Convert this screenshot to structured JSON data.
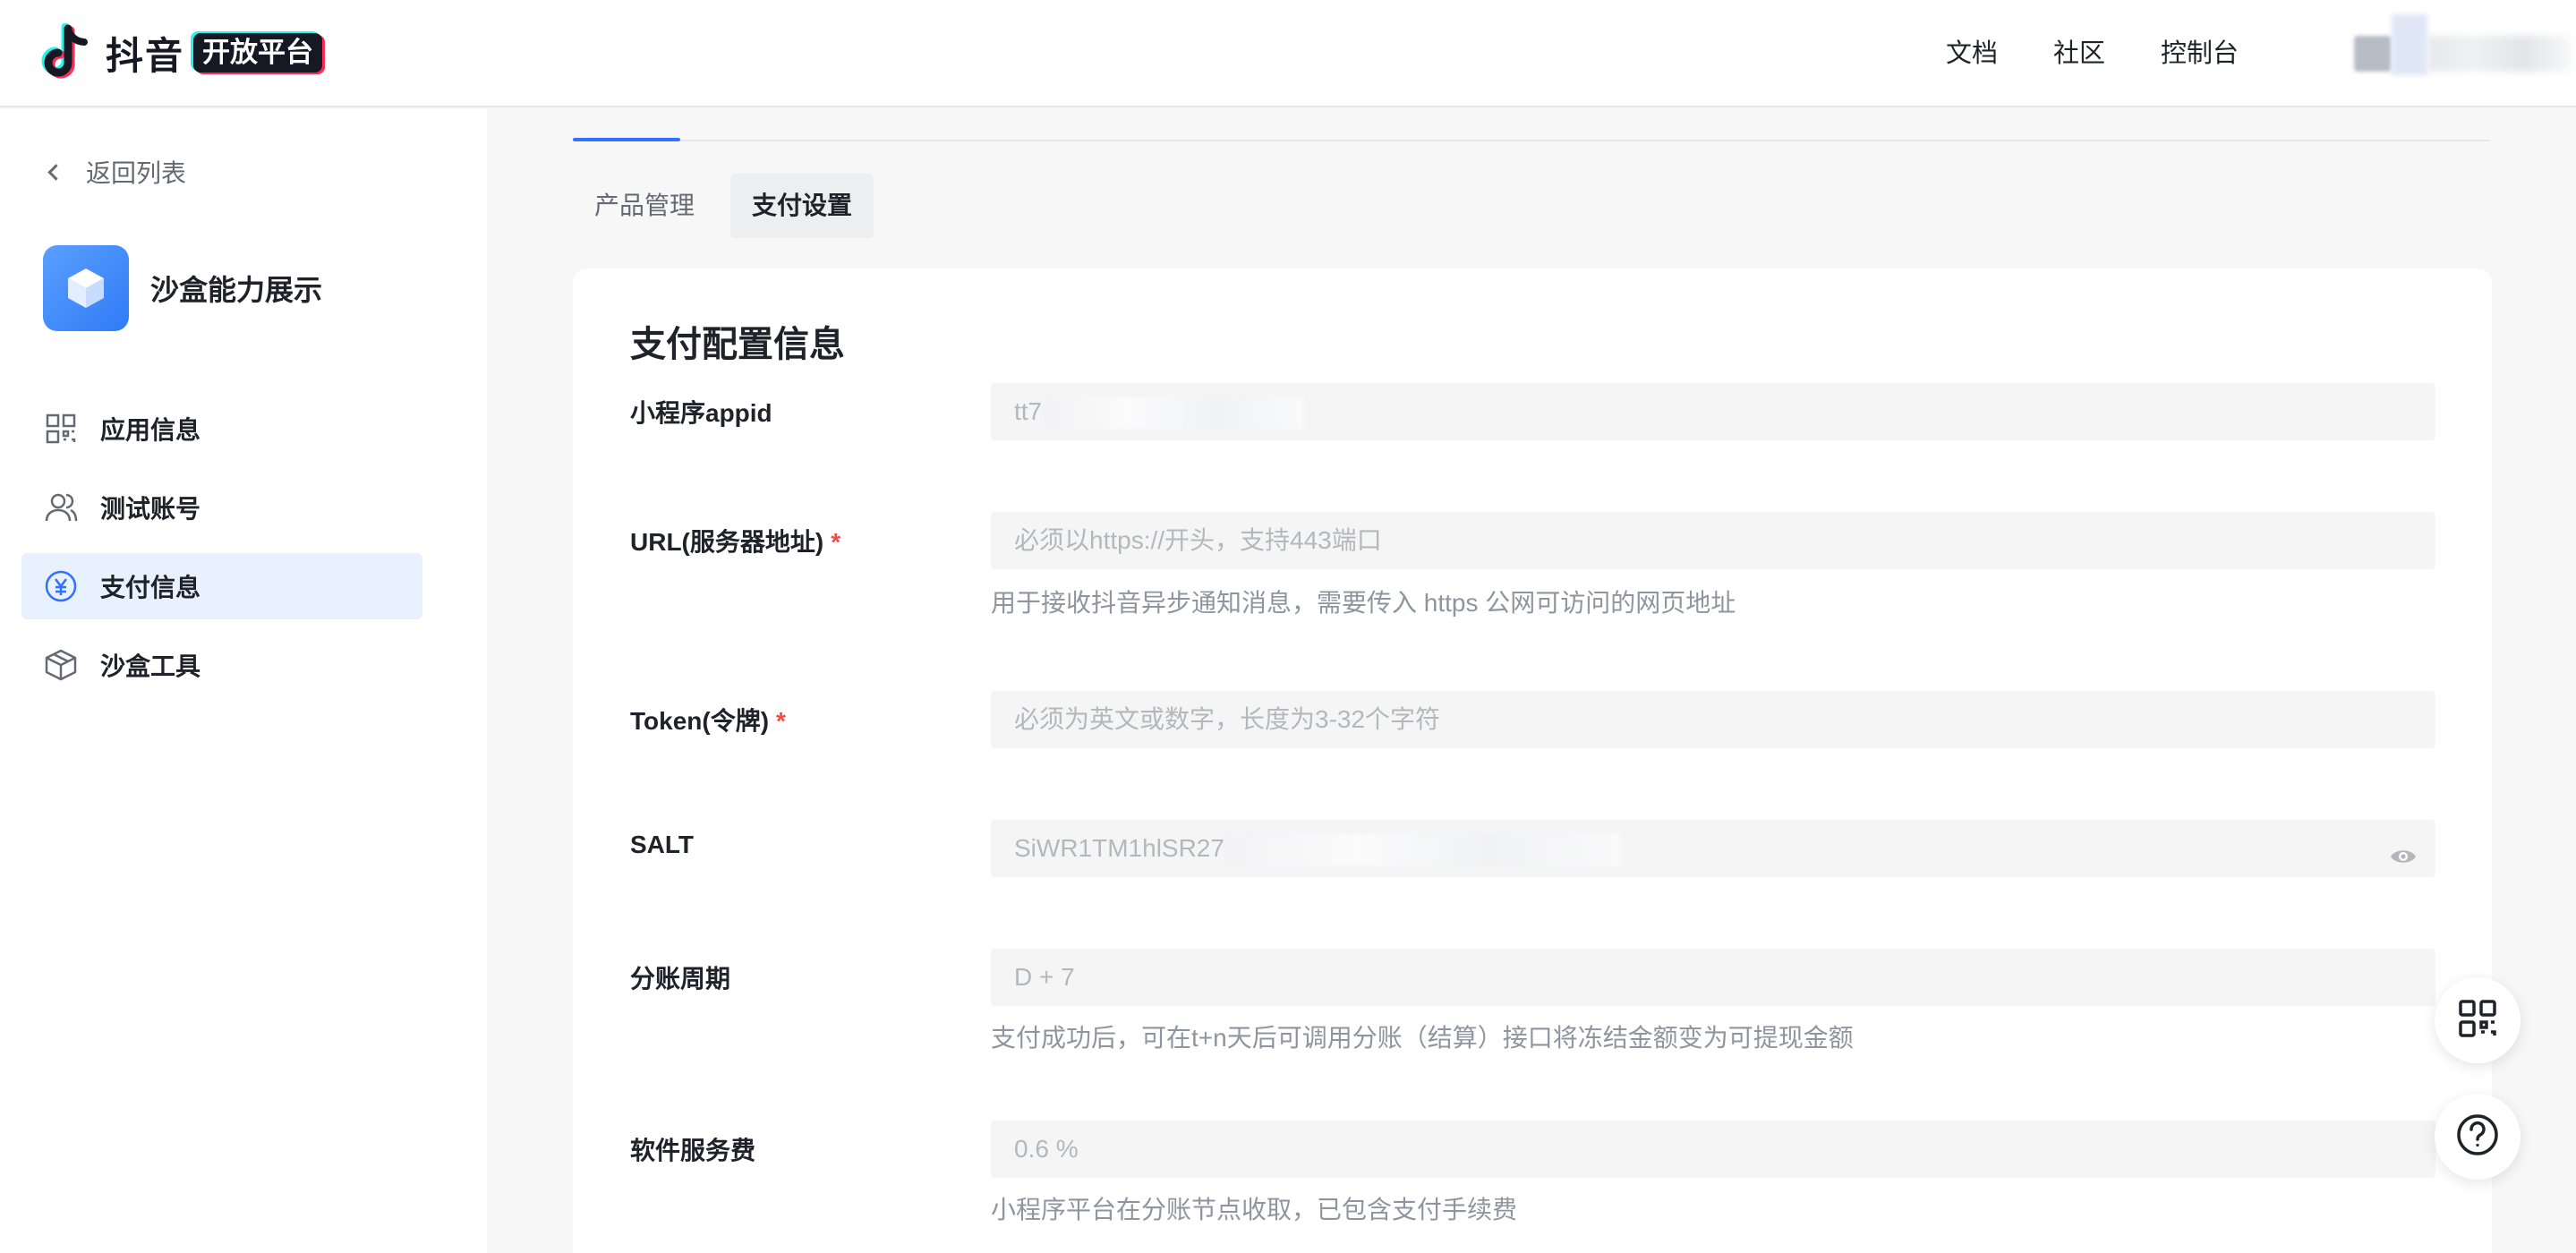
{
  "header": {
    "brand_name": "抖音",
    "brand_badge": "开放平台",
    "nav": [
      "文档",
      "社区",
      "控制台"
    ]
  },
  "sidebar": {
    "back_label": "返回列表",
    "app_name": "沙盒能力展示",
    "items": [
      {
        "label": "应用信息",
        "icon": "grid-icon",
        "active": false
      },
      {
        "label": "测试账号",
        "icon": "users-icon",
        "active": false
      },
      {
        "label": "支付信息",
        "icon": "yuan-circle-icon",
        "active": true
      },
      {
        "label": "沙盒工具",
        "icon": "box-icon",
        "active": false
      }
    ]
  },
  "tabs": {
    "items": [
      "产品管理",
      "支付设置"
    ],
    "active": "支付设置"
  },
  "form": {
    "title": "支付配置信息",
    "fields": [
      {
        "label": "小程序appid",
        "value": "tt7",
        "placeholder": "",
        "hint": "",
        "required": false
      },
      {
        "label": "URL(服务器地址)",
        "value": "",
        "placeholder": "必须以https://开头，支持443端口",
        "hint": "用于接收抖音异步通知消息，需要传入 https 公网可访问的网页地址",
        "required": true
      },
      {
        "label": "Token(令牌)",
        "value": "",
        "placeholder": "必须为英文或数字，长度为3-32个字符",
        "hint": "",
        "required": true
      },
      {
        "label": "SALT",
        "value": "SiWR1TM1hlSR27",
        "placeholder": "",
        "hint": "",
        "required": false
      },
      {
        "label": "分账周期",
        "value": "D + 7",
        "placeholder": "",
        "hint": "支付成功后，可在t+n天后可调用分账（结算）接口将冻结金额变为可提现金额",
        "required": false
      },
      {
        "label": "软件服务费",
        "value": "0.6 %",
        "placeholder": "",
        "hint": "小程序平台在分账节点收取，已包含支付手续费",
        "required": false
      }
    ],
    "required_mark": "*"
  },
  "colors": {
    "primary": "#3370ff",
    "active_bg": "#e8f1fe",
    "required": "#f54a45"
  }
}
